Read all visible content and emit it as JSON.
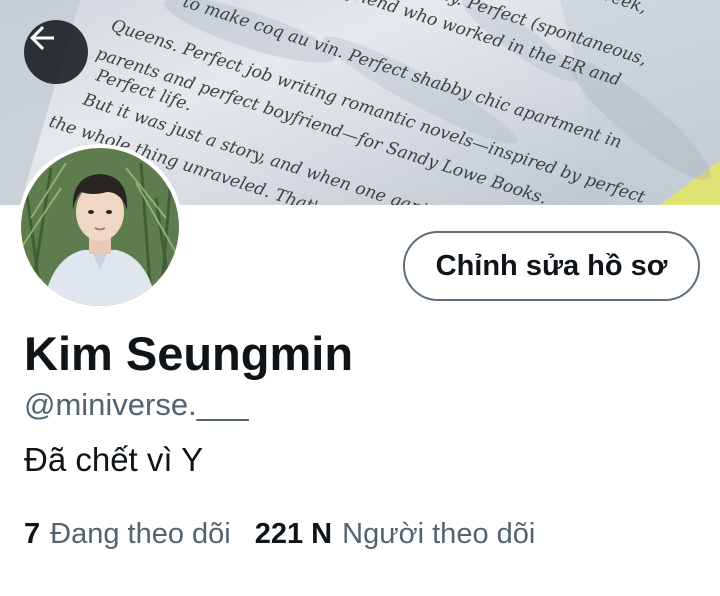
{
  "banner": {
    "book_text_lines": [
      "lly. Perfect (spontaneous,",
      "Queens. Perfect job writing romantic novels—inspired by perfect",
      "parents and perfect boyfriend—for Sandy Lowe Books.",
      "Perfect life.",
      "But it was just a story, and when one gaping plot hole",
      "the whole thing unraveled. That's how stor",
      "to make coq au vin. Perfect shabby chic apartment in",
      "boyfriend who worked in the ER and",
      "al times a week,"
    ],
    "back_icon": "arrow-left-icon"
  },
  "profile": {
    "edit_button_label": "Chỉnh sửa hồ sơ",
    "display_name": "Kim Seungmin",
    "handle": "@miniverse.___",
    "bio": "Đã chết vì Y"
  },
  "stats": {
    "following_count": "7",
    "following_label": "Đang theo dõi",
    "followers_count": "221 N",
    "followers_label": "Người theo dõi"
  }
}
